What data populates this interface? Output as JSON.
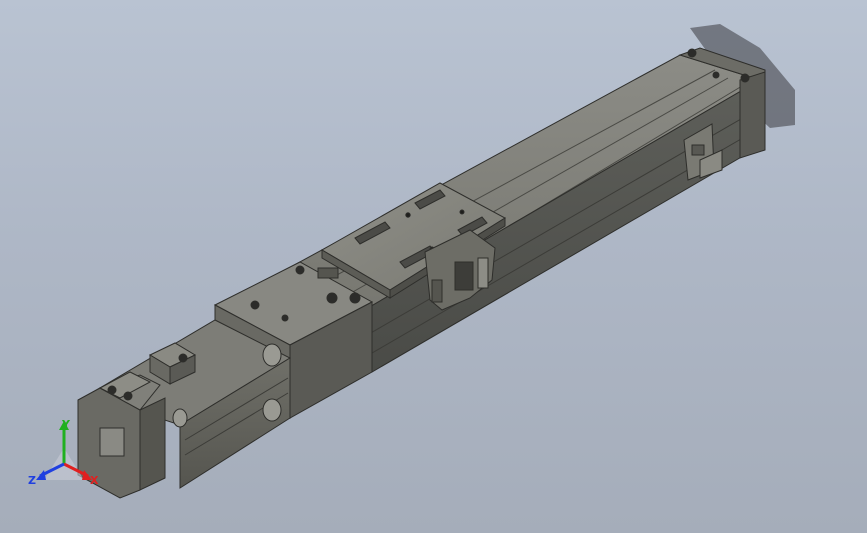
{
  "viewport": {
    "background": "#b0b9c7",
    "model": "linear-module-assembly"
  },
  "triad": {
    "x_label": "X",
    "y_label": "Y",
    "z_label": "Z",
    "x_color": "#e02020",
    "y_color": "#20b020",
    "z_color": "#2040e0"
  }
}
